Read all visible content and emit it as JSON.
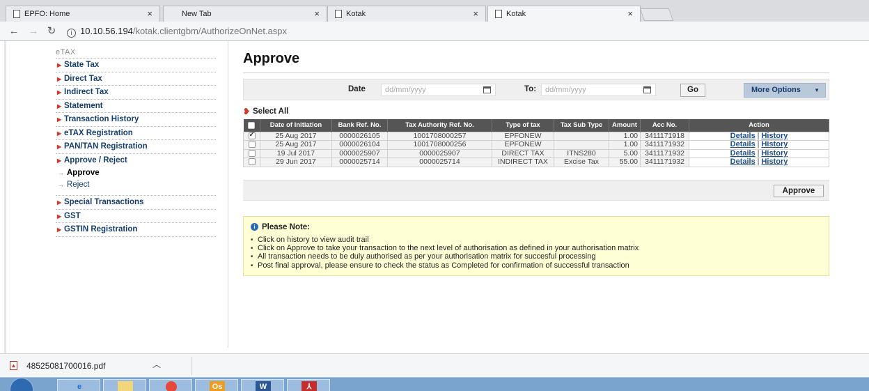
{
  "browser": {
    "tabs": [
      {
        "label": "EPFO: Home"
      },
      {
        "label": "New Tab"
      },
      {
        "label": "Kotak"
      },
      {
        "label": "Kotak"
      }
    ],
    "tab_close_glyph": "×",
    "url_host": "10.10.56.194",
    "url_path": "/kotak.clientgbm/AuthorizeOnNet.aspx"
  },
  "sidebar": {
    "section_title": "eTAX",
    "items": [
      {
        "label": "State Tax"
      },
      {
        "label": "Direct Tax"
      },
      {
        "label": "Indirect Tax"
      },
      {
        "label": "Statement"
      },
      {
        "label": "Transaction History"
      },
      {
        "label": "eTAX Registration"
      },
      {
        "label": "PAN/TAN Registration"
      },
      {
        "label": "Approve / Reject"
      },
      {
        "label": "Special Transactions"
      },
      {
        "label": "GST"
      },
      {
        "label": "GSTIN Registration"
      }
    ],
    "sub_items": [
      {
        "label": "Approve",
        "active": true
      },
      {
        "label": "Reject",
        "active": false
      }
    ]
  },
  "main": {
    "title": "Approve",
    "filter": {
      "date_label": "Date",
      "date_placeholder": "dd/mm/yyyy",
      "to_label": "To:",
      "to_placeholder": "dd/mm/yyyy",
      "go_label": "Go",
      "more_options_label": "More Options"
    },
    "select_all_label": "Select All",
    "table": {
      "columns": [
        "Date of Initiation",
        "Bank Ref. No.",
        "Tax Authority Ref. No.",
        "Type of tax",
        "Tax Sub Type",
        "Amount",
        "Acc No.",
        "Action"
      ],
      "rows": [
        {
          "checked": true,
          "date": "25 Aug 2017",
          "bank_ref": "0000026105",
          "tax_ref": "1001708000257",
          "type": "EPFONEW",
          "sub_type": "",
          "amount": "1.00",
          "acc": "3411171918"
        },
        {
          "checked": false,
          "date": "25 Aug 2017",
          "bank_ref": "0000026104",
          "tax_ref": "1001708000256",
          "type": "EPFONEW",
          "sub_type": "",
          "amount": "1.00",
          "acc": "3411171932"
        },
        {
          "checked": false,
          "date": "19 Jul 2017",
          "bank_ref": "0000025907",
          "tax_ref": "0000025907",
          "type": "DIRECT TAX",
          "sub_type": "ITNS280",
          "amount": "5.00",
          "acc": "3411171932"
        },
        {
          "checked": false,
          "date": "29 Jun 2017",
          "bank_ref": "0000025714",
          "tax_ref": "0000025714",
          "type": "INDIRECT TAX",
          "sub_type": "Excise Tax",
          "amount": "55.00",
          "acc": "3411171932"
        }
      ],
      "details_label": "Details",
      "separator": "|",
      "history_label": "History"
    },
    "approve_button": "Approve",
    "note": {
      "heading": "Please Note:",
      "items": [
        "Click on history to view audit trail",
        "Click on Approve to take your transaction to the next level of authorisation as defined in your authorisation matrix",
        "All transaction needs to be duly authorised as per your authorisation matrix for succesful processing",
        "Post final approval, please ensure to check the status as Completed for confirmation of successful transaction"
      ]
    }
  },
  "download": {
    "filename": "48525081700016.pdf"
  }
}
